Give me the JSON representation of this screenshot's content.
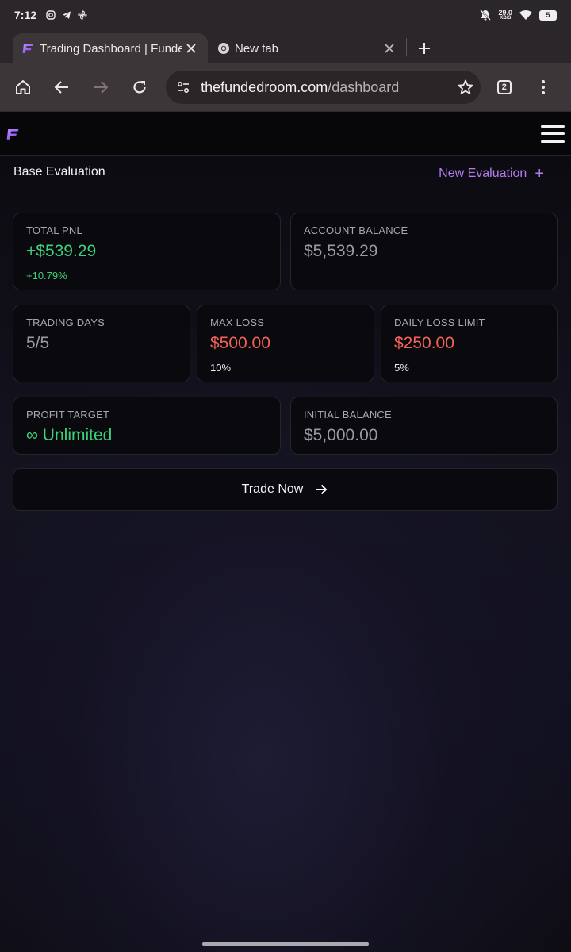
{
  "status_bar": {
    "time": "7:12",
    "left_icons": [
      "instagram-icon",
      "telegram-icon",
      "pinwheel-icon"
    ],
    "net_speed_value": "29.0",
    "net_speed_unit": "KB/S",
    "battery_level": "5"
  },
  "browser": {
    "tabs": [
      {
        "title": "Trading Dashboard | Funded Room",
        "active": true,
        "favicon": "funded-room-logo"
      },
      {
        "title": "New tab",
        "active": false,
        "favicon": "chrome-icon"
      }
    ],
    "url_host": "thefundedroom.com",
    "url_path": "/dashboard",
    "tab_count": "2"
  },
  "app": {
    "section_title": "Base Evaluation",
    "new_evaluation_label": "New Evaluation",
    "cards": {
      "total_pnl": {
        "label": "TOTAL PNL",
        "value": "+$539.29",
        "sub": "+10.79%"
      },
      "account_balance": {
        "label": "ACCOUNT BALANCE",
        "value": "$5,539.29"
      },
      "trading_days": {
        "label": "TRADING DAYS",
        "value": "5/5"
      },
      "max_loss": {
        "label": "MAX LOSS",
        "value": "$500.00",
        "sub": "10%"
      },
      "daily_loss_limit": {
        "label": "DAILY LOSS LIMIT",
        "value": "$250.00",
        "sub": "5%"
      },
      "profit_target": {
        "label": "PROFIT TARGET",
        "value": "∞ Unlimited"
      },
      "initial_balance": {
        "label": "INITIAL BALANCE",
        "value": "$5,000.00"
      }
    },
    "trade_now_label": "Trade Now"
  },
  "colors": {
    "accent_purple": "#b57cf0",
    "positive_green": "#3ed07a",
    "negative_red": "#f26357"
  }
}
